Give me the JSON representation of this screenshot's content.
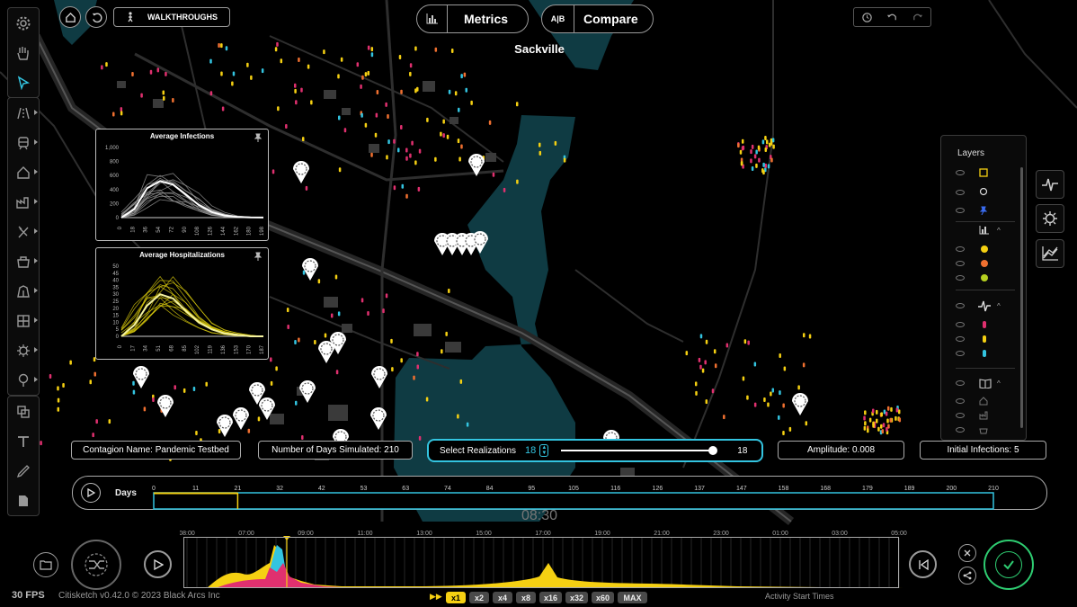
{
  "top_nav": {
    "walkthroughs_label": "WALKTHROUGHS",
    "metrics_label": "Metrics",
    "compare_prefix": "A|B",
    "compare_label": "Compare"
  },
  "map": {
    "place_label": "Sackville",
    "clock": "08:30"
  },
  "chart_data": [
    {
      "type": "line",
      "title": "Average Infections",
      "x": [
        0,
        18,
        36,
        54,
        72,
        90,
        108,
        126,
        144,
        162,
        180,
        198
      ],
      "ylim": [
        0,
        1000
      ],
      "yticks": [
        "1,000",
        "800",
        "600",
        "400",
        "200",
        "0"
      ],
      "series": [
        {
          "values": [
            0,
            120,
            420,
            520,
            470,
            330,
            180,
            80,
            30,
            10,
            3,
            1
          ]
        }
      ]
    },
    {
      "type": "line",
      "title": "Average Hospitalizations",
      "x": [
        0,
        17,
        34,
        51,
        68,
        85,
        102,
        119,
        136,
        153,
        170,
        187
      ],
      "ylim": [
        0,
        50
      ],
      "yticks": [
        "50",
        "45",
        "40",
        "35",
        "30",
        "25",
        "20",
        "15",
        "10",
        "5",
        "0"
      ],
      "series": [
        {
          "values": [
            0,
            8,
            22,
            30,
            27,
            18,
            10,
            5,
            2,
            1,
            0,
            0
          ]
        }
      ]
    }
  ],
  "info_bar": {
    "contagion": "Contagion Name: Pandemic Testbed",
    "days_simulated": "Number of Days Simulated: 210",
    "select_realizations_label": "Select Realizations",
    "realizations_value": "18",
    "realizations_max": "18",
    "amplitude": "Amplitude: 0.008",
    "initial_infections": "Initial Infections: 5"
  },
  "timeline": {
    "label": "Days",
    "ticks": [
      "0",
      "11",
      "21",
      "32",
      "42",
      "53",
      "63",
      "74",
      "84",
      "95",
      "105",
      "116",
      "126",
      "137",
      "147",
      "158",
      "168",
      "179",
      "189",
      "200",
      "210"
    ],
    "progress_fraction": 0.1
  },
  "activity": {
    "hours": [
      "08:00",
      "07:00",
      "09:00",
      "11:00",
      "13:00",
      "15:00",
      "17:00",
      "19:00",
      "21:00",
      "23:00",
      "01:00",
      "03:00",
      "05:00"
    ],
    "caption": "Activity Start Times"
  },
  "status": {
    "fps": "30 FPS",
    "version": "Citisketch v0.42.0 © 2023 Black Arcs Inc"
  },
  "speeds": [
    "x1",
    "x2",
    "x4",
    "x8",
    "x16",
    "x32",
    "x60",
    "MAX"
  ],
  "layers": {
    "title": "Layers"
  },
  "colors": {
    "accent": "#33c4e0",
    "yellow": "#f5d012",
    "water": "#0f3b43",
    "magenta": "#e0306f",
    "green": "#2ecc71"
  }
}
